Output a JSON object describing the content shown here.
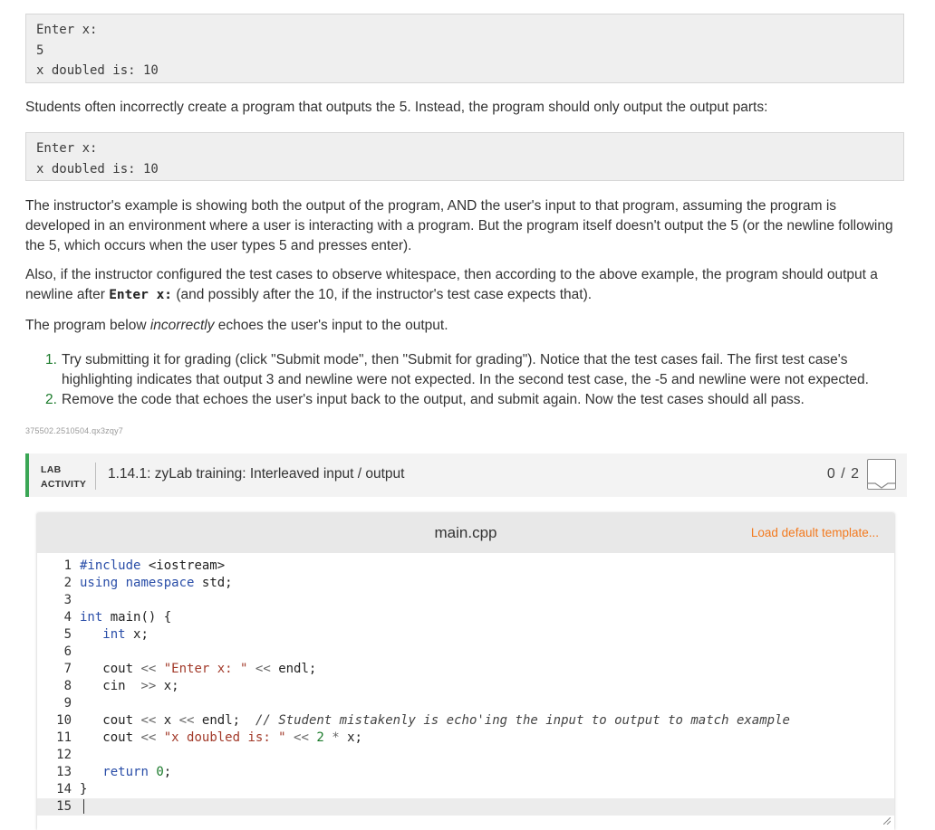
{
  "example_full": [
    "Enter x:",
    "5",
    "x doubled is: 10"
  ],
  "para_students": "Students often incorrectly create a program that outputs the 5. Instead, the program should only output the output parts:",
  "example_output": [
    "Enter x:",
    "x doubled is: 10"
  ],
  "para_instructor": "The instructor's example is showing both the output of the program, AND the user's input to that program, assuming the program is developed in an environment where a user is interacting with a program. But the program itself doesn't output the 5 (or the newline following the 5, which occurs when the user types 5 and presses enter).",
  "para_whitespace": {
    "before": "Also, if the instructor configured the test cases to observe whitespace, then according to the above example, the program should output a newline after ",
    "code": "Enter x:",
    "after": " (and possibly after the 10, if the instructor's test case expects that)."
  },
  "para_below": {
    "before": "The program below ",
    "em": "incorrectly",
    "after": " echoes the user's input to the output."
  },
  "steps": [
    {
      "num": "1.",
      "text": "Try submitting it for grading (click \"Submit mode\", then \"Submit for grading\"). Notice that the test cases fail. The first test case's highlighting indicates that output 3 and newline were not expected. In the second test case, the -5 and newline were not expected."
    },
    {
      "num": "2.",
      "text": "Remove the code that echoes the user's input back to the output, and submit again. Now the test cases should all pass."
    }
  ],
  "activity_id": "375502.2510504.qx3zqy7",
  "lab": {
    "tag_line1": "LAB",
    "tag_line2": "ACTIVITY",
    "title": "1.14.1: zyLab training: Interleaved input / output",
    "score": "0 / 2",
    "accent_color": "#3aa655"
  },
  "editor": {
    "file_name": "main.cpp",
    "load_template": "Load default template...",
    "line_numbers": [
      "1",
      "2",
      "3",
      "4",
      "5",
      "6",
      "7",
      "8",
      "9",
      "10",
      "11",
      "12",
      "13",
      "14",
      "15"
    ],
    "code_lines": [
      "#include <iostream>",
      "using namespace std;",
      "",
      "int main() {",
      "   int x;",
      "",
      "   cout << \"Enter x: \" << endl;",
      "   cin  >> x;",
      "",
      "   cout << x << endl;  // Student mistakenly is echo'ing the input to output to match example",
      "   cout << \"x doubled is: \" << 2 * x;",
      "",
      "   return 0;",
      "}",
      ""
    ]
  }
}
